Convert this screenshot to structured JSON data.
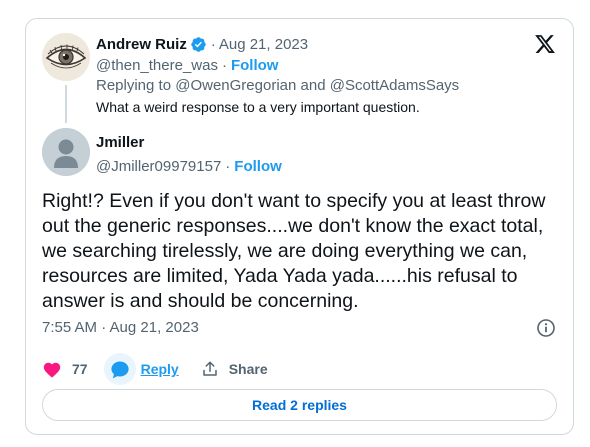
{
  "parent_tweet": {
    "author_name": "Andrew Ruiz",
    "separator": "·",
    "date": "Aug 21, 2023",
    "handle": "@then_there_was",
    "dot": "·",
    "follow_label": "Follow",
    "replying_prefix": "Replying to",
    "replying_to_1": "@OwenGregorian",
    "replying_and": "and",
    "replying_to_2": "@ScottAdamsSays",
    "text": "What a weird response to a very important question."
  },
  "tweet": {
    "author_name": "Jmiller",
    "handle": "@Jmiller09979157",
    "dot": "·",
    "follow_label": "Follow",
    "text": "Right!? Even if you don't want to specify you at least throw out the generic responses....we don't know the exact total, we searching tirelessly, we are doing everything we can, resources are limited, Yada Yada yada......his refusal to answer is and should be concerning.",
    "timestamp": "7:55 AM · Aug 21, 2023"
  },
  "actions": {
    "like_count": "77",
    "reply_label": "Reply",
    "share_label": "Share"
  },
  "read_replies_label": "Read 2 replies",
  "icons": {
    "brand": "x-logo-icon",
    "verified": "verified-badge-icon",
    "info": "info-icon",
    "like": "heart-icon",
    "reply": "speech-bubble-icon",
    "share": "share-icon"
  },
  "colors": {
    "accent": "#1d9bf0",
    "like": "#f91880",
    "text_primary": "#0f1419",
    "text_secondary": "#536471",
    "border": "#cfd9de",
    "read_replies": "#006fd6"
  }
}
